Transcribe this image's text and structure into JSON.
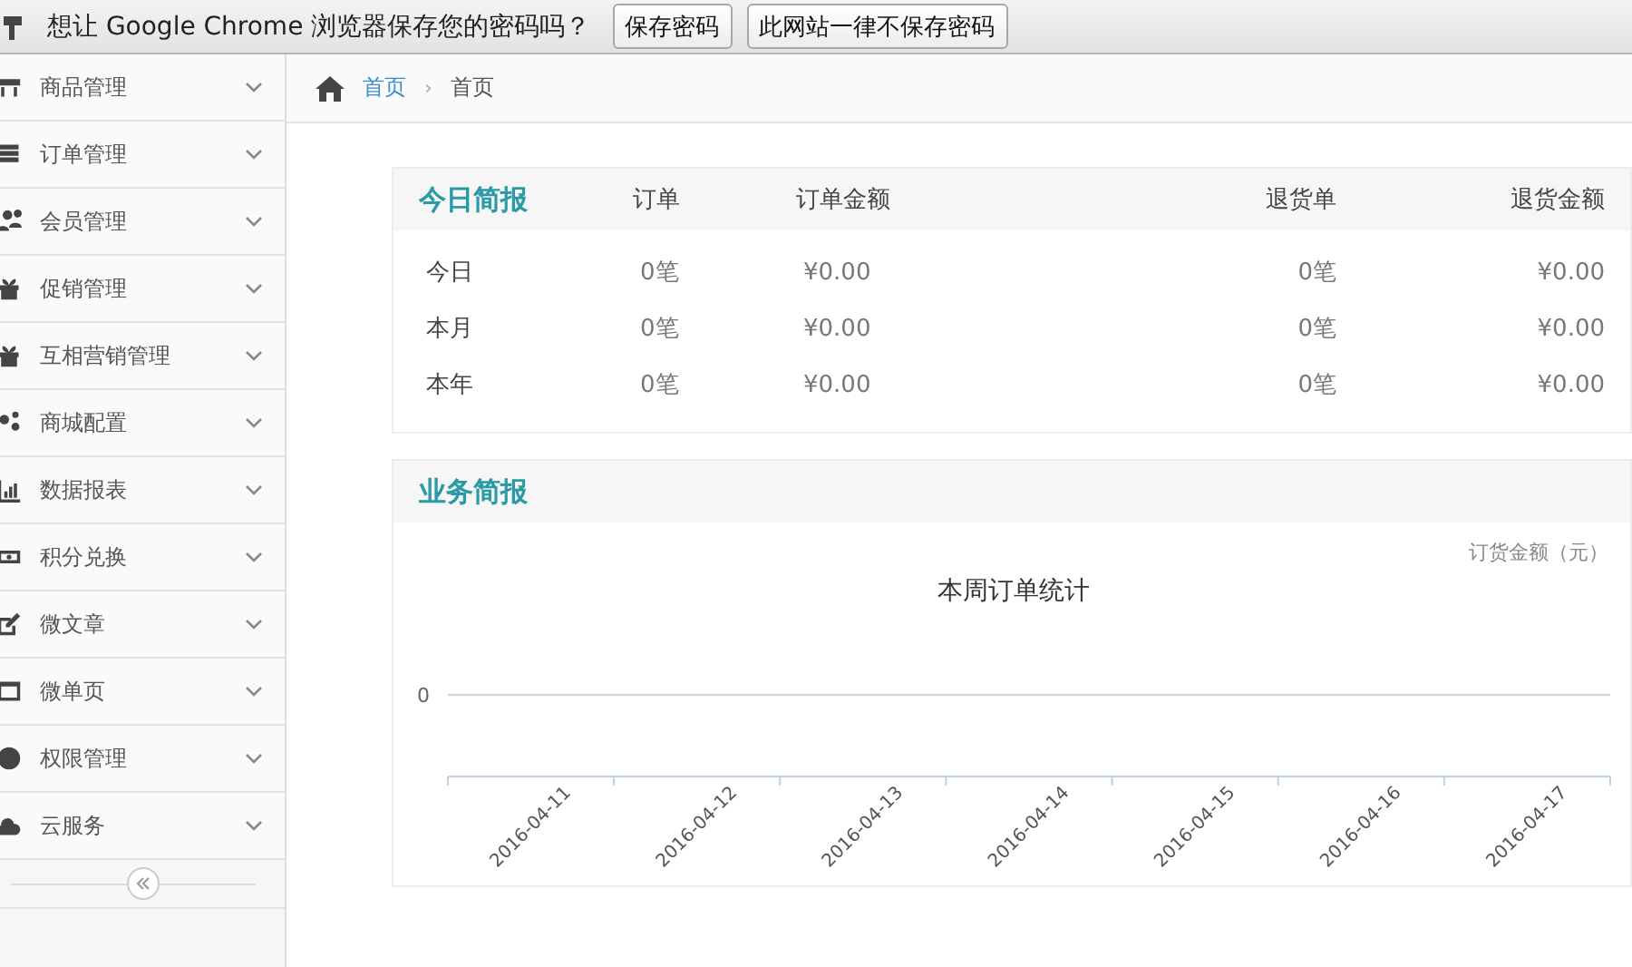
{
  "password_bar": {
    "message": "想让 Google Chrome 浏览器保存您的密码吗？",
    "buttons": [
      "保存密码",
      "此网站一律不保存密码"
    ]
  },
  "sidebar": {
    "items": [
      {
        "label": "商品管理"
      },
      {
        "label": "订单管理"
      },
      {
        "label": "会员管理"
      },
      {
        "label": "促销管理"
      },
      {
        "label": "互相营销管理"
      },
      {
        "label": "商城配置"
      },
      {
        "label": "数据报表"
      },
      {
        "label": "积分兑换"
      },
      {
        "label": "微文章"
      },
      {
        "label": "微单页"
      },
      {
        "label": "权限管理"
      },
      {
        "label": "云服务"
      }
    ]
  },
  "breadcrumb": {
    "separator": "›",
    "items": [
      {
        "label": "首页",
        "link": true
      },
      {
        "label": "首页",
        "link": false
      }
    ]
  },
  "today_report": {
    "title": "今日简报",
    "columns": [
      "订单",
      "订单金额",
      "退货单",
      "退货金额"
    ],
    "rows": [
      {
        "label": "今日",
        "cells": [
          "0笔",
          "¥0.00",
          "0笔",
          "¥0.00"
        ]
      },
      {
        "label": "本月",
        "cells": [
          "0笔",
          "¥0.00",
          "0笔",
          "¥0.00"
        ]
      },
      {
        "label": "本年",
        "cells": [
          "0笔",
          "¥0.00",
          "0笔",
          "¥0.00"
        ]
      }
    ]
  },
  "business_report": {
    "title": "业务简报",
    "zero_label": "0",
    "chart_data": {
      "type": "other",
      "title": "本周订单统计",
      "ylabel": "订货金额（元）",
      "categories": [
        "2016-04-11",
        "2016-04-12",
        "2016-04-13",
        "2016-04-14",
        "2016-04-15",
        "2016-04-16",
        "2016-04-17"
      ]
    }
  }
}
